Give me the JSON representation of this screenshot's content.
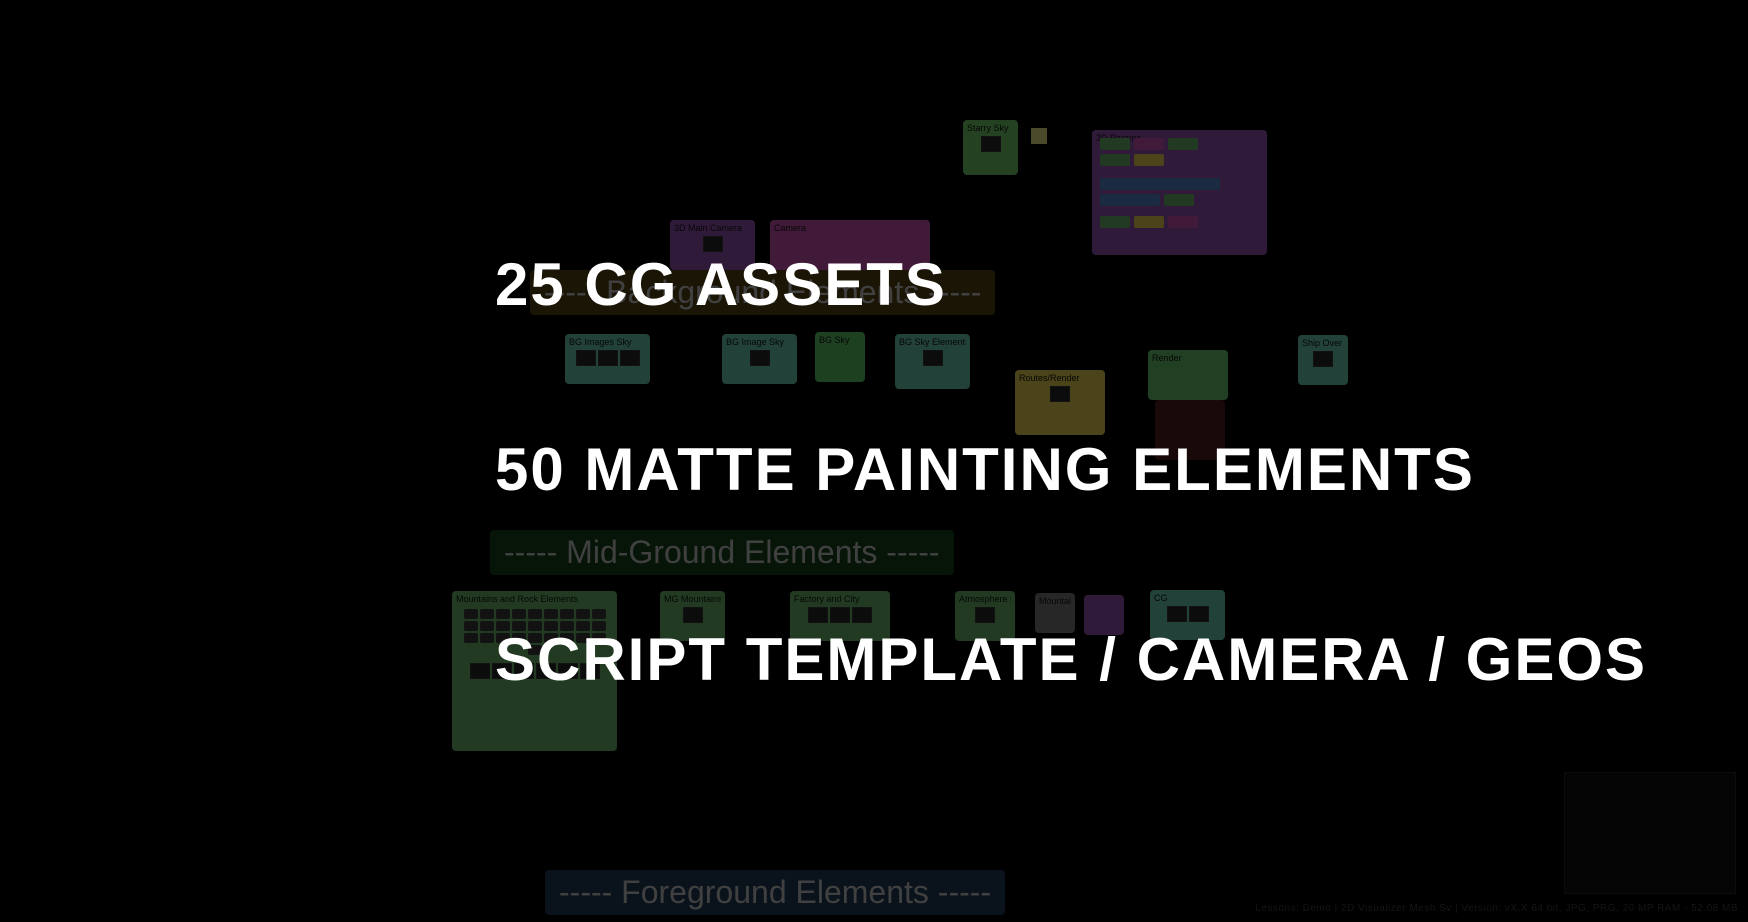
{
  "overlay": {
    "line1": "25 CG ASSETS",
    "line2": "50 MATTE PAINTING ELEMENTS",
    "line3": "SCRIPT TEMPLATE / CAMERA / GEOS"
  },
  "sections": {
    "background": "----- Background Elements -----",
    "midground": "----- Mid-Ground Elements -----",
    "foreground": "----- Foreground Elements -----"
  },
  "nodes": {
    "g1": "Starry Sky",
    "g2": "BG Images Sky",
    "g3": "BG Image Sky",
    "g4": "BG Sky",
    "g5": "BG Sky Elements",
    "g6": "Render",
    "g7": "Ship Over fil",
    "g8": "Mountains and Rock Elements",
    "g9": "MG Mountains",
    "g10": "Factory and City",
    "g11": "Atmosphere MG",
    "g12": "CG",
    "p1": "3D Main Camera",
    "p2": "Camera",
    "p3title": "3D Params",
    "p4": "",
    "y1": "Routes/Render",
    "gr1": "Mountains"
  },
  "status": "Lessons: Demo | 2D Visualizer Mesh Sv | Version: vX.X 64 bit, JPG, PRG, 20 MP RAM - 52.08 MB"
}
